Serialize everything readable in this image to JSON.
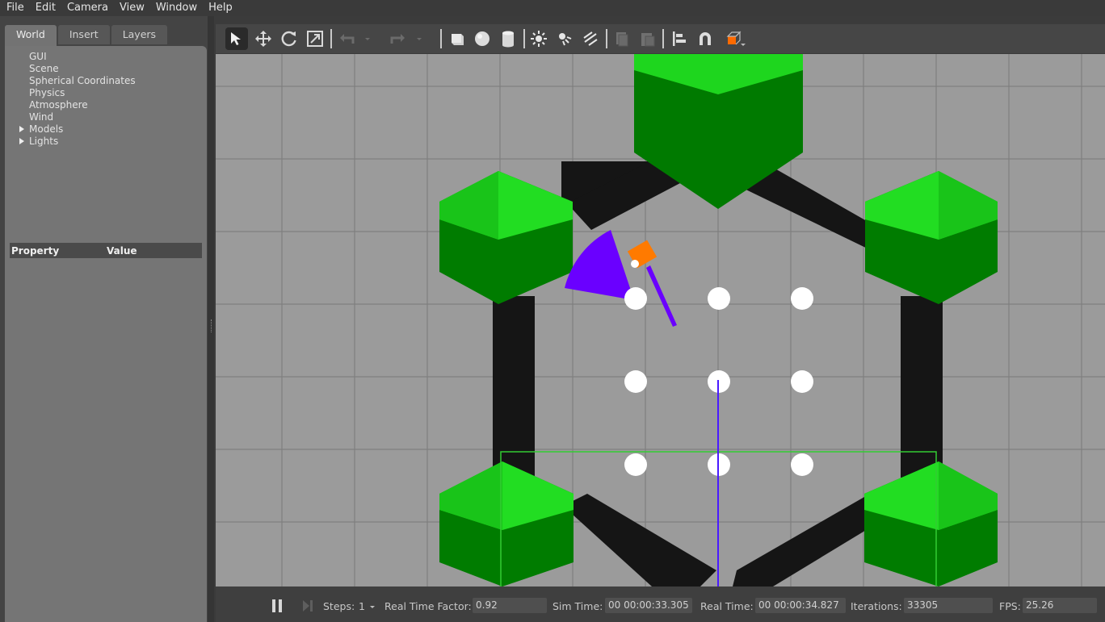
{
  "menu": [
    "File",
    "Edit",
    "Camera",
    "View",
    "Window",
    "Help"
  ],
  "tabs": [
    "World",
    "Insert",
    "Layers"
  ],
  "tree": {
    "items": [
      {
        "label": "GUI",
        "expandable": false
      },
      {
        "label": "Scene",
        "expandable": false
      },
      {
        "label": "Spherical Coordinates",
        "expandable": false
      },
      {
        "label": "Physics",
        "expandable": false
      },
      {
        "label": "Atmosphere",
        "expandable": false
      },
      {
        "label": "Wind",
        "expandable": false
      },
      {
        "label": "Models",
        "expandable": true
      },
      {
        "label": "Lights",
        "expandable": true
      }
    ]
  },
  "properties": {
    "col_property": "Property",
    "col_value": "Value"
  },
  "toolbar": {
    "icons": [
      "select-mode-icon",
      "translate-mode-icon",
      "rotate-mode-icon",
      "scale-mode-icon",
      "undo-icon",
      "undo-dropdown-icon",
      "redo-icon",
      "redo-dropdown-icon",
      "box-shape-icon",
      "sphere-shape-icon",
      "cylinder-shape-icon",
      "point-light-icon",
      "spot-light-icon",
      "directional-light-icon",
      "copy-icon",
      "paste-icon",
      "align-icon",
      "snap-icon",
      "view-angle-icon"
    ]
  },
  "colors": {
    "viewport_bg": "#9a9a9a",
    "green_light": "#19d119",
    "green_dark": "#007a00",
    "wall": "#141414",
    "laser": "#6a00ff",
    "robot": "#ff7a00",
    "waypoint": "#ffffff",
    "selection_box": "#33cc33"
  },
  "bottom": {
    "steps_label": "Steps:",
    "steps_value": "1",
    "rtf_label": "Real Time Factor:",
    "rtf_value": "0.92",
    "sim_label": "Sim Time:",
    "sim_value": "00 00:00:33.305",
    "real_label": "Real Time:",
    "real_value": "00 00:00:34.827",
    "iter_label": "Iterations:",
    "iter_value": "33305",
    "fps_label": "FPS:",
    "fps_value": "25.26"
  }
}
